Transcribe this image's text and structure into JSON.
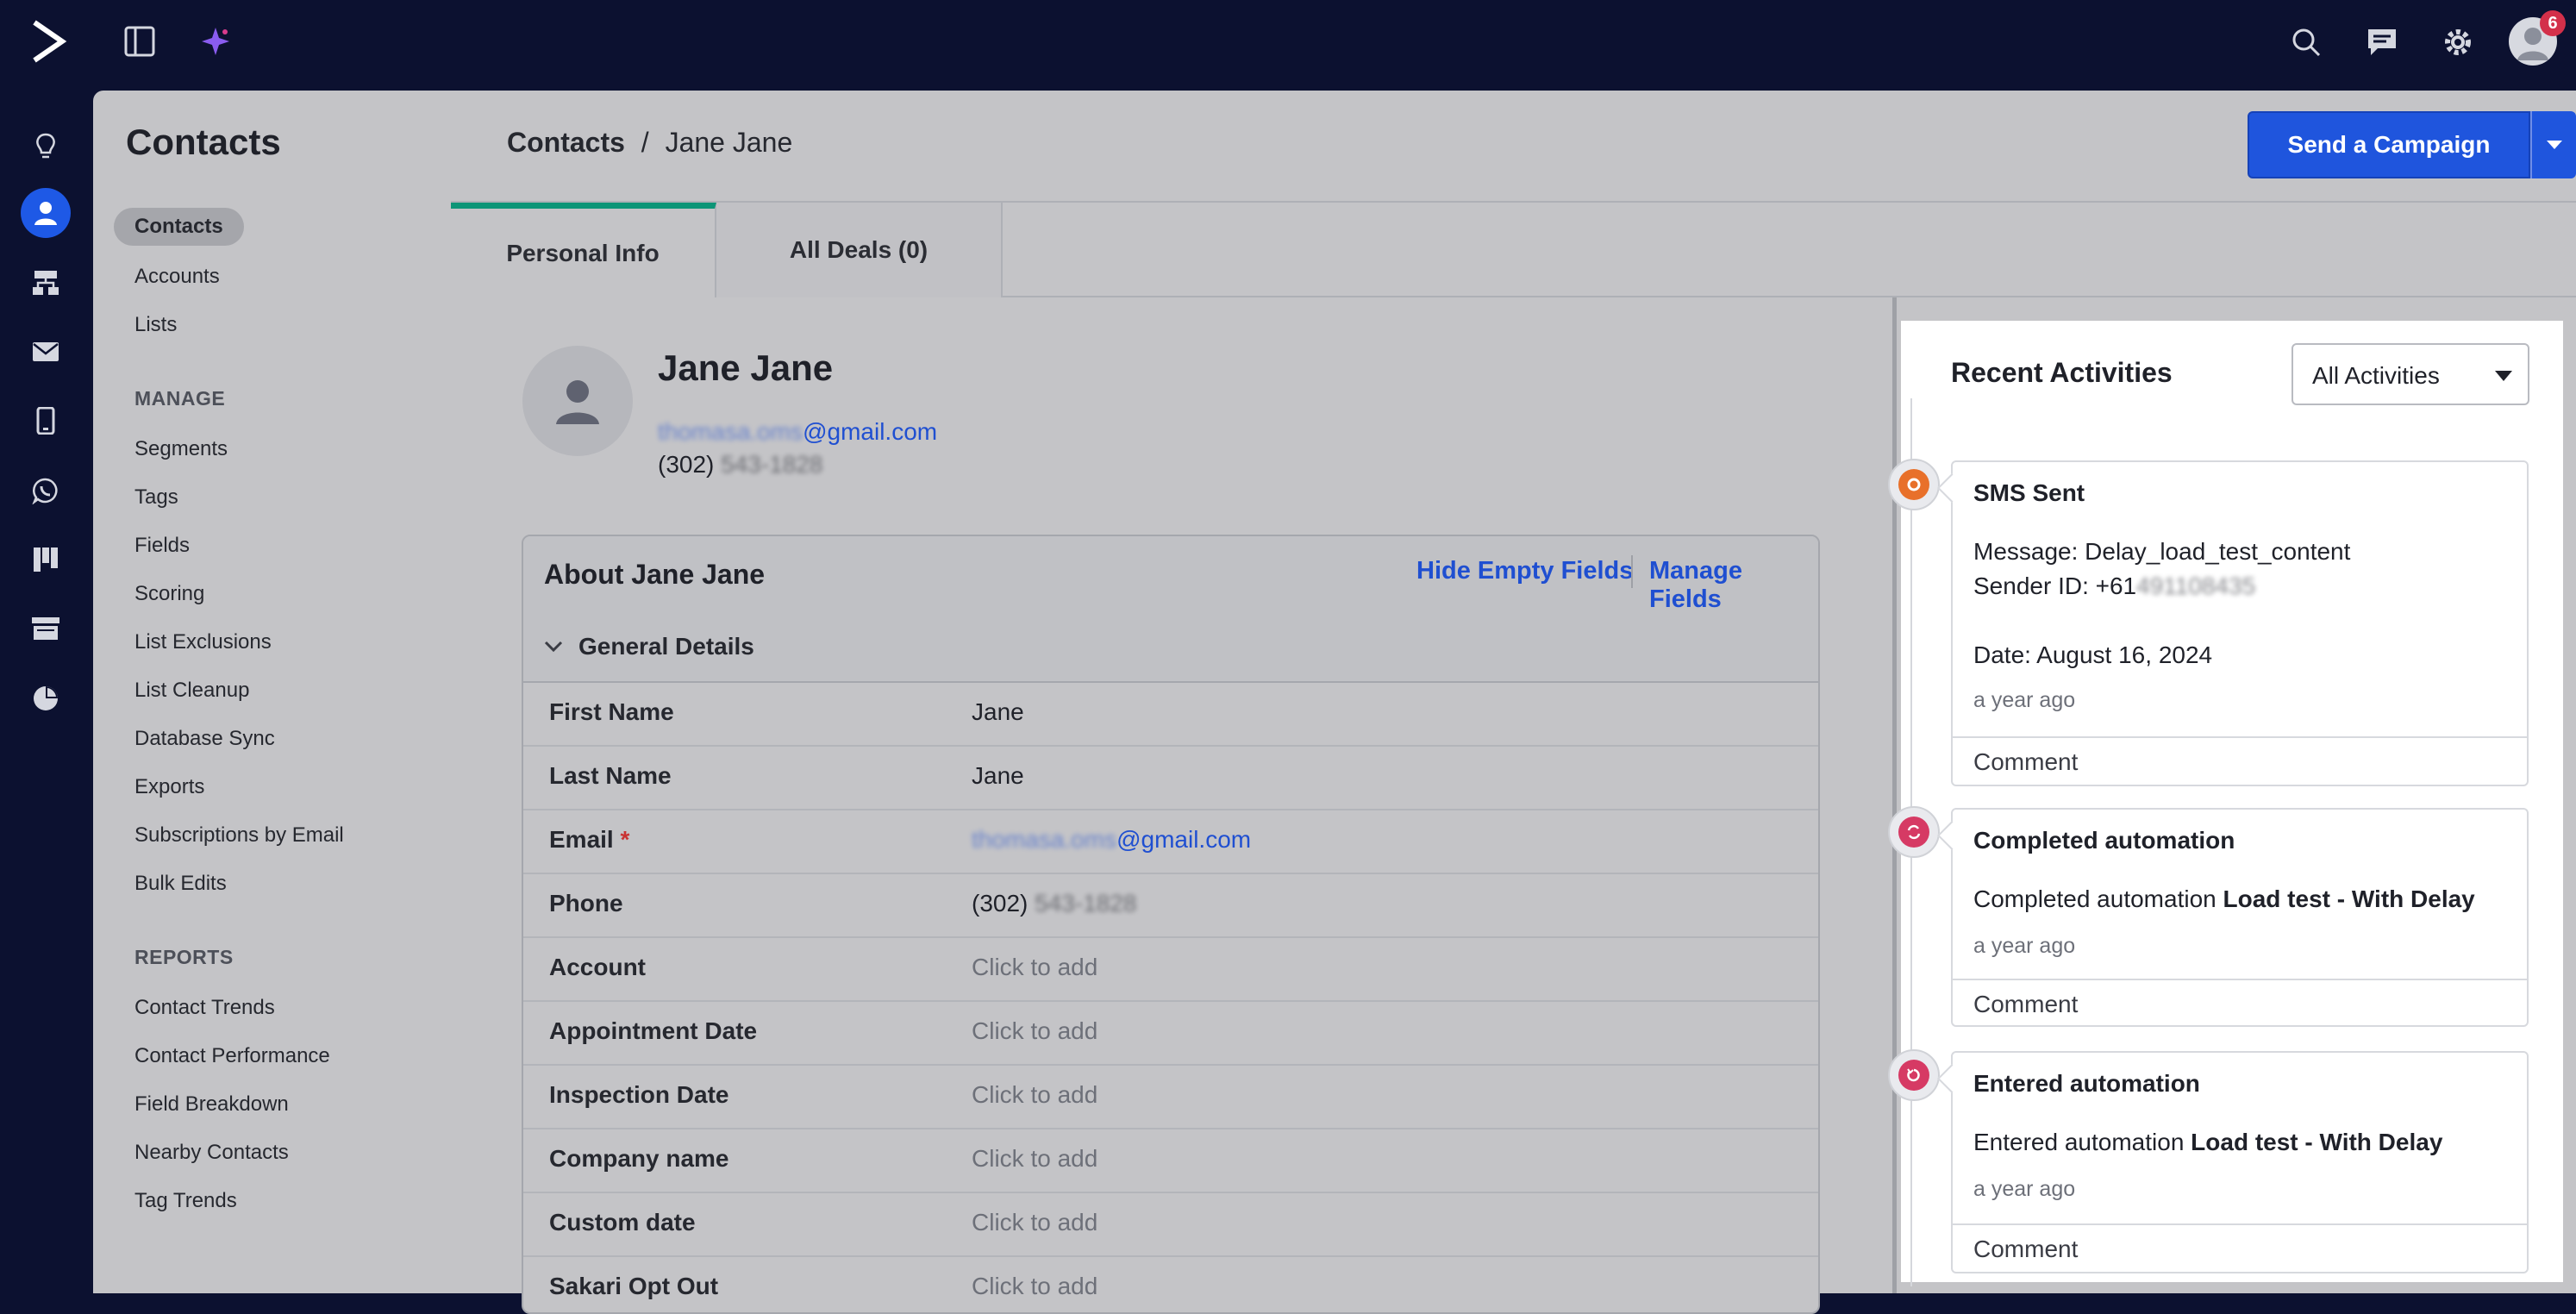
{
  "topbar": {
    "icons": [
      "logo-icon",
      "panel-toggle-icon",
      "sparkle-icon",
      "search-icon",
      "chat-icon",
      "gear-icon",
      "avatar"
    ],
    "notification_count": "6"
  },
  "rail": {
    "icons": [
      "lightbulb-icon",
      "contacts-icon",
      "automations-icon",
      "mail-icon",
      "mobile-icon",
      "whatsapp-icon",
      "kanban-icon",
      "store-icon",
      "pie-chart-icon"
    ],
    "active": "contacts-icon"
  },
  "subnav": {
    "title": "Contacts",
    "items": [
      "Contacts",
      "Accounts",
      "Lists"
    ],
    "manage_label": "MANAGE",
    "manage_items": [
      "Segments",
      "Tags",
      "Fields",
      "Scoring",
      "List Exclusions",
      "List Cleanup",
      "Database Sync",
      "Exports",
      "Subscriptions by Email",
      "Bulk Edits"
    ],
    "reports_label": "REPORTS",
    "reports_items": [
      "Contact Trends",
      "Contact Performance",
      "Field Breakdown",
      "Nearby Contacts",
      "Tag Trends"
    ]
  },
  "header": {
    "breadcrumb_root": "Contacts",
    "breadcrumb_sep": "/",
    "breadcrumb_current": "Jane Jane",
    "campaign_button": "Send a Campaign"
  },
  "tabs": [
    "Personal Info",
    "All Deals (0)"
  ],
  "contact": {
    "name": "Jane Jane",
    "email_hidden": "thomasa.oms",
    "email_domain": "@gmail.com",
    "phone_area": "(302)",
    "phone_hidden": "543-1828"
  },
  "about": {
    "title": "About Jane Jane",
    "hide_empty": "Hide Empty Fields",
    "manage_fields": "Manage Fields",
    "section": "General Details",
    "rows": [
      {
        "label": "First Name",
        "value": "Jane"
      },
      {
        "label": "Last Name",
        "value": "Jane"
      },
      {
        "label": "Email",
        "required": "*",
        "value_hidden": "thomasa.oms",
        "value": "@gmail.com"
      },
      {
        "label": "Phone",
        "value": "(302)",
        "value_hidden": "543-1828"
      },
      {
        "label": "Account",
        "value": "Click to add"
      },
      {
        "label": "Appointment Date",
        "value": "Click to add"
      },
      {
        "label": "Inspection Date",
        "value": "Click to add"
      },
      {
        "label": "Company name",
        "value": "Click to add"
      },
      {
        "label": "Custom date",
        "value": "Click to add"
      },
      {
        "label": "Sakari Opt Out",
        "value": "Click to add"
      }
    ]
  },
  "activities": {
    "title": "Recent Activities",
    "filter": "All Activities",
    "items": [
      {
        "title": "SMS Sent",
        "line1": "Message: Delay_load_test_content",
        "line2_prefix": "Sender ID: +61",
        "line2_hidden": "491108435",
        "line3": "Date: August 16, 2024",
        "ago": "a year ago",
        "comment": "Comment",
        "icon": "sms-icon",
        "color": "#e8702a"
      },
      {
        "title": "Completed automation",
        "text_prefix": "Completed automation",
        "text_bold": "Load test - With Delay",
        "ago": "a year ago",
        "comment": "Comment",
        "icon": "automation-complete-icon",
        "color": "#d63a64"
      },
      {
        "title": "Entered automation",
        "text_prefix": "Entered automation",
        "text_bold": "Load test - With Delay",
        "ago": "a year ago",
        "comment": "Comment",
        "icon": "automation-enter-icon",
        "color": "#d63a64"
      }
    ]
  }
}
